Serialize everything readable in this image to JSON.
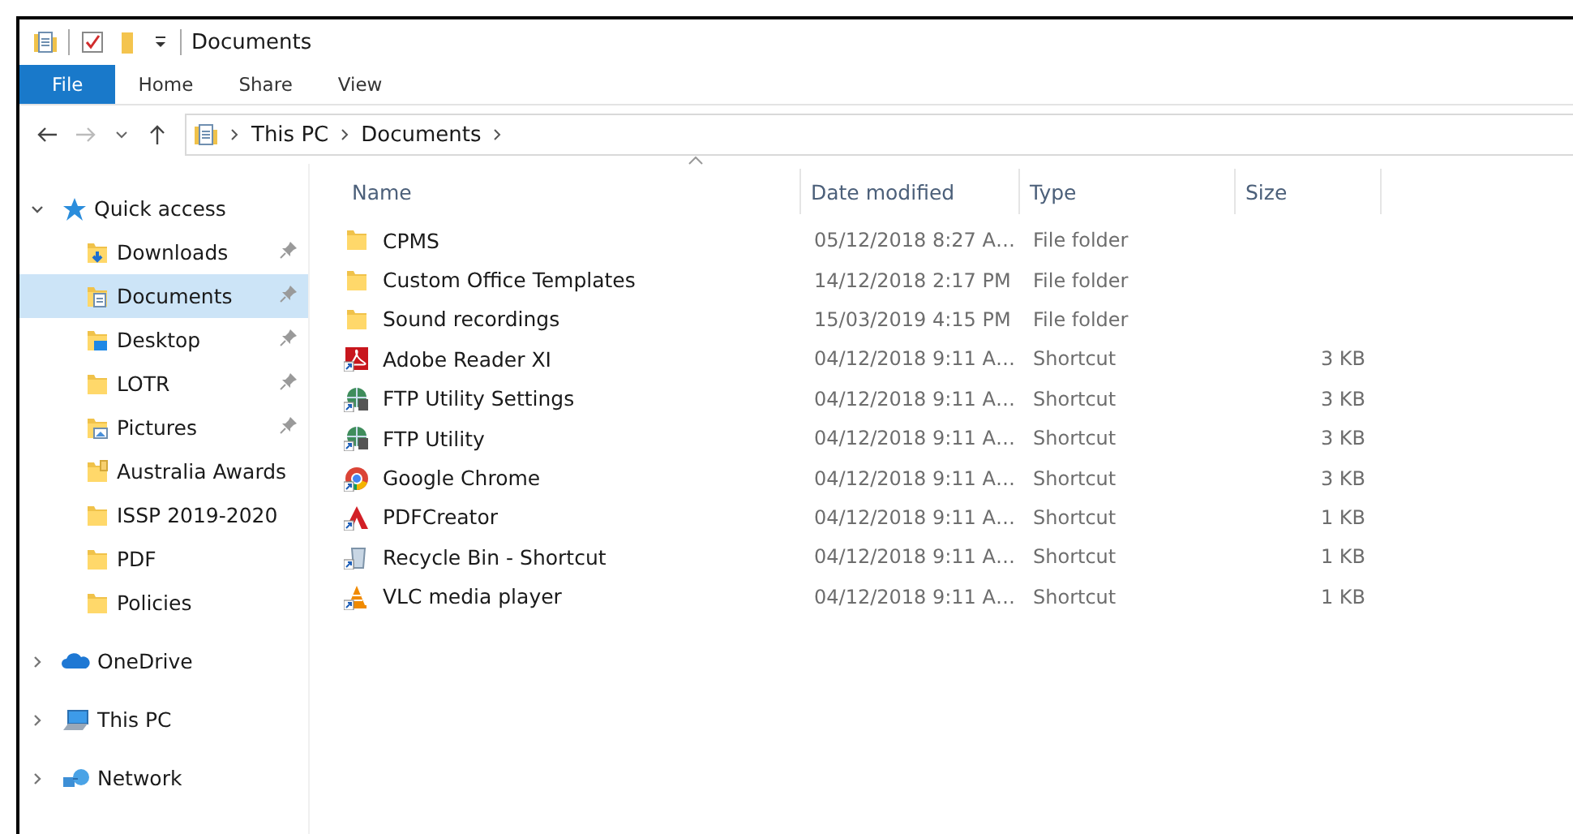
{
  "window": {
    "title": "Documents"
  },
  "ribbon_tabs": [
    {
      "label": "File",
      "selected": true
    },
    {
      "label": "Home",
      "selected": false
    },
    {
      "label": "Share",
      "selected": false
    },
    {
      "label": "View",
      "selected": false
    }
  ],
  "address_bar": {
    "path": [
      {
        "label": "This PC"
      },
      {
        "label": "Documents"
      }
    ]
  },
  "sidebar": {
    "items": [
      {
        "label": "Quick access",
        "kind": "star",
        "expanded": true,
        "children": [
          {
            "label": "Downloads",
            "kind": "downloads",
            "pinned": true,
            "selected": false
          },
          {
            "label": "Documents",
            "kind": "documents",
            "pinned": true,
            "selected": true
          },
          {
            "label": "Desktop",
            "kind": "desktop",
            "pinned": true,
            "selected": false
          },
          {
            "label": "LOTR",
            "kind": "folder",
            "pinned": true,
            "selected": false
          },
          {
            "label": "Pictures",
            "kind": "pictures",
            "pinned": true,
            "selected": false
          },
          {
            "label": "Australia Awards",
            "kind": "shared",
            "pinned": false,
            "selected": false
          },
          {
            "label": "ISSP 2019-2020",
            "kind": "folder",
            "pinned": false,
            "selected": false
          },
          {
            "label": "PDF",
            "kind": "folder",
            "pinned": false,
            "selected": false
          },
          {
            "label": "Policies",
            "kind": "folder",
            "pinned": false,
            "selected": false
          }
        ]
      },
      {
        "label": "OneDrive",
        "kind": "cloud",
        "expanded": false
      },
      {
        "label": "This PC",
        "kind": "pc",
        "expanded": false
      },
      {
        "label": "Network",
        "kind": "network",
        "expanded": false
      }
    ]
  },
  "table": {
    "columns": [
      "Name",
      "Date modified",
      "Type",
      "Size"
    ],
    "rows": [
      {
        "name": "CPMS",
        "kind": "folder",
        "date": "05/12/2018 8:27 A…",
        "type": "File folder",
        "size": ""
      },
      {
        "name": "Custom Office Templates",
        "kind": "folder",
        "date": "14/12/2018 2:17 PM",
        "type": "File folder",
        "size": ""
      },
      {
        "name": "Sound recordings",
        "kind": "folder",
        "date": "15/03/2019 4:15 PM",
        "type": "File folder",
        "size": ""
      },
      {
        "name": "Adobe Reader XI",
        "kind": "reader",
        "date": "04/12/2018 9:11 A…",
        "type": "Shortcut",
        "size": "3 KB"
      },
      {
        "name": "FTP Utility Settings",
        "kind": "ftp",
        "date": "04/12/2018 9:11 A…",
        "type": "Shortcut",
        "size": "3 KB"
      },
      {
        "name": "FTP Utility",
        "kind": "ftp",
        "date": "04/12/2018 9:11 A…",
        "type": "Shortcut",
        "size": "3 KB"
      },
      {
        "name": "Google Chrome",
        "kind": "chrome",
        "date": "04/12/2018 9:11 A…",
        "type": "Shortcut",
        "size": "3 KB"
      },
      {
        "name": "PDFCreator",
        "kind": "creator",
        "date": "04/12/2018 9:11 A…",
        "type": "Shortcut",
        "size": "1 KB"
      },
      {
        "name": "Recycle Bin - Shortcut",
        "kind": "recycle",
        "date": "04/12/2018 9:11 A…",
        "type": "Shortcut",
        "size": "1 KB"
      },
      {
        "name": "VLC media player",
        "kind": "vlc",
        "date": "04/12/2018 9:11 A…",
        "type": "Shortcut",
        "size": "1 KB"
      }
    ]
  }
}
